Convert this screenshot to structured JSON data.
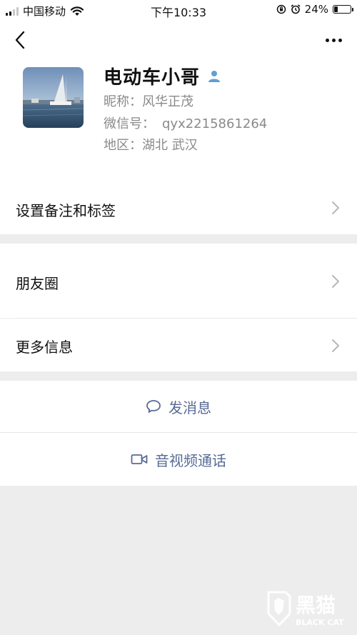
{
  "status_bar": {
    "carrier": "中国移动",
    "time": "下午10:33",
    "battery_percent": "24%",
    "battery_level": 0.24,
    "signal_bars_filled": 2,
    "signal_bars_total": 4
  },
  "header": {
    "back_icon": "chevron-left-icon",
    "more_icon": "more-dots-icon"
  },
  "profile": {
    "name": "电动车小哥",
    "gender_icon": "male-user-icon",
    "gender_color": "#5ea0d6",
    "nickname_label": "昵称：",
    "nickname": "风华正茂",
    "wechat_id_label": "微信号：",
    "wechat_id": "qyx2215861264",
    "region_label": "地区：",
    "region": "湖北 武汉"
  },
  "menu": {
    "remarks_tags": "设置备注和标签",
    "moments": "朋友圈",
    "more_info": "更多信息"
  },
  "actions": {
    "send_message": "发消息",
    "video_call": "音视频通话",
    "accent_color": "#576b95"
  },
  "watermark": {
    "text": "黑猫",
    "subtext": "BLACK CAT"
  }
}
